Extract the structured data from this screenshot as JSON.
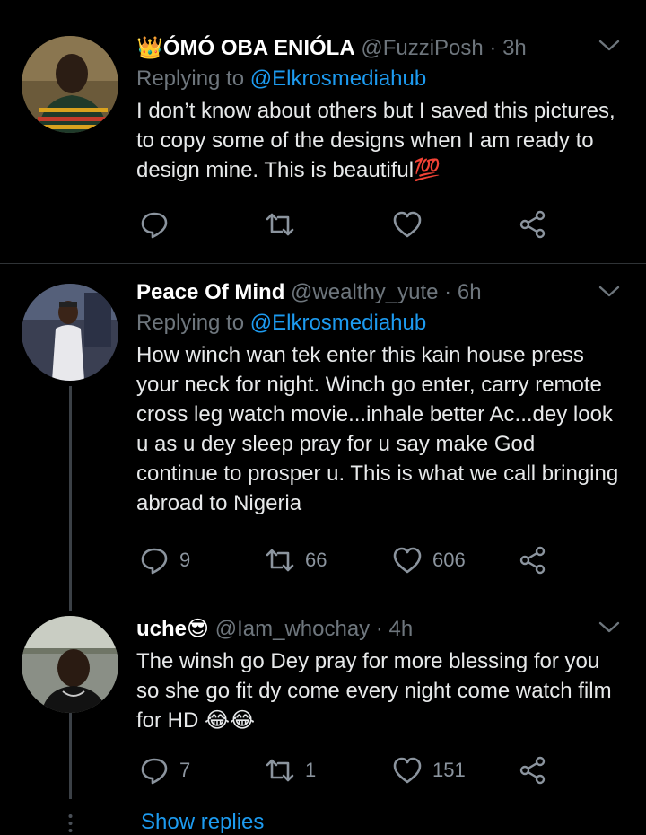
{
  "tweets": [
    {
      "name": "👑ÓMÓ OBA ENIÓLA",
      "handle": "@FuzziPosh",
      "dot": "·",
      "time": "3h",
      "replying_prefix": "Replying to",
      "replying_to": "@Elkrosmediahub",
      "text": "I don’t know about others but I saved this pictures, to copy some of the designs when I am ready to design mine. This is beautiful💯",
      "replies": "",
      "retweets": "",
      "likes": ""
    },
    {
      "name": "Peace Of Mind",
      "handle": "@wealthy_yute",
      "dot": "·",
      "time": "6h",
      "replying_prefix": "Replying to",
      "replying_to": "@Elkrosmediahub",
      "text": "How winch wan tek enter this kain house press your neck for night. Winch go enter, carry remote cross leg watch movie...inhale better Ac...dey look u as u dey sleep pray for u say make God continue to prosper u. This is what we call bringing abroad to Nigeria",
      "replies": "9",
      "retweets": "66",
      "likes": "606"
    },
    {
      "name": "uche😎",
      "handle": "@Iam_whochay",
      "dot": "·",
      "time": "4h",
      "text": "The winsh go Dey pray for more blessing for you so she go fit dy come every night come watch film for HD 😂😂",
      "replies": "7",
      "retweets": "1",
      "likes": "151"
    }
  ],
  "show_replies": "Show replies",
  "icons": {
    "reply": "reply-icon",
    "retweet": "retweet-icon",
    "like": "heart-icon",
    "share": "share-icon",
    "more": "chevron-down-icon"
  },
  "colors": {
    "background": "#000000",
    "link": "#1d9bf0",
    "muted": "#6e767d",
    "text": "#e7e9ea"
  }
}
